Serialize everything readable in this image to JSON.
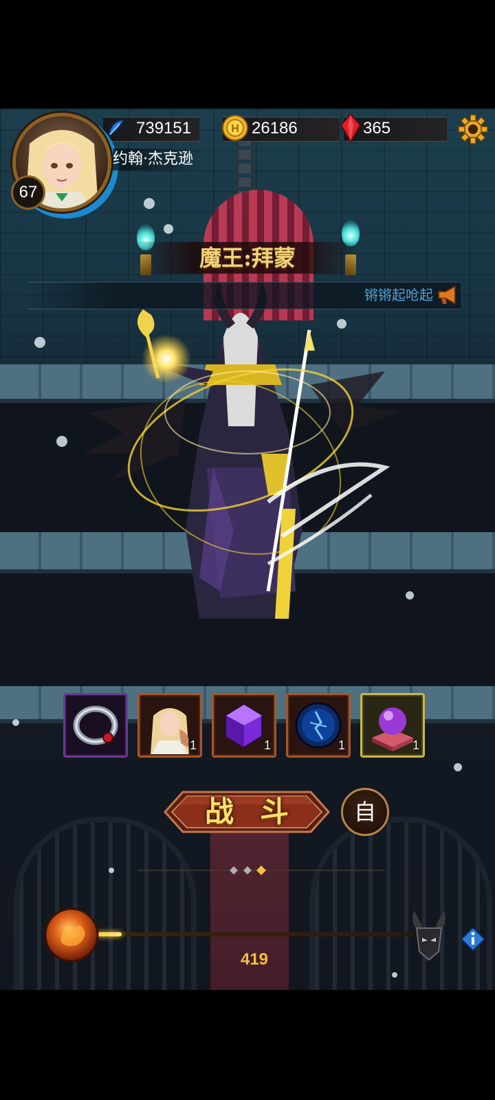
{
  "player": {
    "level": "67",
    "name": "约翰·杰克逊"
  },
  "resources": {
    "power": "739151",
    "gold": "26186",
    "gems": "365"
  },
  "boss": {
    "title": "魔王:拜蒙"
  },
  "marquee": {
    "text": "锵锵起呛起"
  },
  "rewards": [
    {
      "item": "ring-icon",
      "count": "",
      "frame": "purple"
    },
    {
      "item": "elf-hero-card-icon",
      "count": "1",
      "frame": "orange"
    },
    {
      "item": "purple-crystal-icon",
      "count": "1",
      "frame": "orange"
    },
    {
      "item": "blue-rune-orb-icon",
      "count": "1",
      "frame": "orange"
    },
    {
      "item": "purple-orb-pedestal-icon",
      "count": "1",
      "frame": "gold"
    }
  ],
  "actions": {
    "battle_label": "战斗",
    "auto_label": "自"
  },
  "stage": {
    "number": "419",
    "progress": 0.08
  },
  "colors": {
    "accent_gold": "#f3d37a",
    "marquee_blue": "#4fa3d9",
    "stage_number": "#f0c040"
  }
}
